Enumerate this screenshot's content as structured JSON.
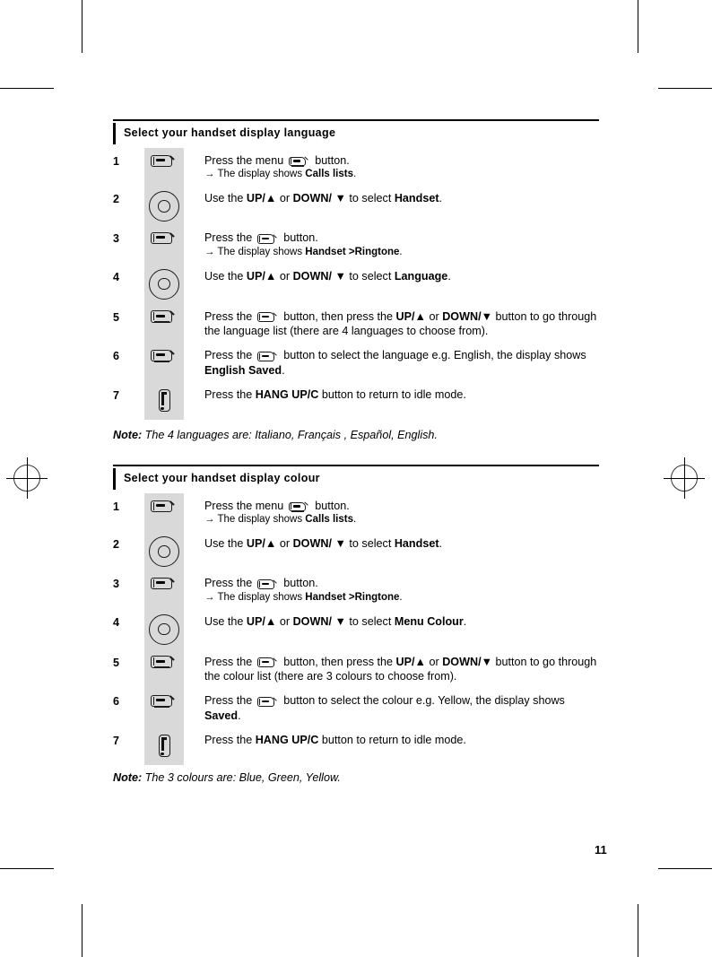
{
  "page": {
    "number": "11"
  },
  "sections": [
    {
      "id": "language",
      "title": "Select your handset display language",
      "steps": [
        {
          "num": "1",
          "icon": "menu-button-icon",
          "lines": [
            {
              "parts": [
                {
                  "t": "Press the menu "
                },
                {
                  "icon": "menu"
                },
                {
                  "t": " button."
                }
              ]
            },
            {
              "sub": true,
              "parts": [
                {
                  "t": "→ The display shows "
                },
                {
                  "b": "Calls lists"
                },
                {
                  "t": "."
                }
              ]
            }
          ]
        },
        {
          "num": "2",
          "icon": "navigation-wheel-icon",
          "lines": [
            {
              "parts": [
                {
                  "t": "Use the "
                },
                {
                  "b": "UP/▲"
                },
                {
                  "t": " or "
                },
                {
                  "b": "DOWN/ ▼"
                },
                {
                  "t": " to select "
                },
                {
                  "b": "Handset"
                },
                {
                  "t": "."
                }
              ]
            }
          ]
        },
        {
          "num": "3",
          "icon": "menu-button-icon",
          "lines": [
            {
              "parts": [
                {
                  "t": "Press the "
                },
                {
                  "icon": "menu"
                },
                {
                  "t": " button."
                }
              ]
            },
            {
              "sub": true,
              "parts": [
                {
                  "t": "→ The display shows "
                },
                {
                  "b": "Handset  >Ringtone"
                },
                {
                  "t": "."
                }
              ]
            }
          ]
        },
        {
          "num": "4",
          "icon": "navigation-wheel-icon",
          "lines": [
            {
              "parts": [
                {
                  "t": "Use the "
                },
                {
                  "b": "UP/▲"
                },
                {
                  "t": " or "
                },
                {
                  "b": "DOWN/ ▼"
                },
                {
                  "t": " to select "
                },
                {
                  "b": "Language"
                },
                {
                  "t": "."
                }
              ]
            }
          ]
        },
        {
          "num": "5",
          "icon": "menu-button-icon",
          "lines": [
            {
              "parts": [
                {
                  "t": "Press the "
                },
                {
                  "icon": "menu"
                },
                {
                  "t": " button, then press the "
                },
                {
                  "b": "UP/▲"
                },
                {
                  "t": " or "
                },
                {
                  "b": "DOWN/▼"
                },
                {
                  "t": " button to go through the language list (there are 4 languages to choose from)."
                }
              ]
            }
          ]
        },
        {
          "num": "6",
          "icon": "menu-button-icon",
          "lines": [
            {
              "parts": [
                {
                  "t": "Press the "
                },
                {
                  "icon": "menu"
                },
                {
                  "t": " button to select the language e.g. English, the display shows "
                },
                {
                  "b": "English Saved"
                },
                {
                  "t": "."
                }
              ]
            }
          ]
        },
        {
          "num": "7",
          "icon": "hang-up-icon",
          "lines": [
            {
              "parts": [
                {
                  "t": "Press the "
                },
                {
                  "b": "HANG UP/C"
                },
                {
                  "t": " button to return to idle mode."
                }
              ]
            }
          ]
        }
      ],
      "note_label": "Note:",
      "note_text": " The 4 languages are: Italiano, Français , Español, English."
    },
    {
      "id": "colour",
      "title": "Select your handset display colour",
      "steps": [
        {
          "num": "1",
          "icon": "menu-button-icon",
          "lines": [
            {
              "parts": [
                {
                  "t": "Press the menu "
                },
                {
                  "icon": "menu"
                },
                {
                  "t": " button."
                }
              ]
            },
            {
              "sub": true,
              "parts": [
                {
                  "t": "→ The display shows "
                },
                {
                  "b": "Calls lists"
                },
                {
                  "t": "."
                }
              ]
            }
          ]
        },
        {
          "num": "2",
          "icon": "navigation-wheel-icon",
          "lines": [
            {
              "parts": [
                {
                  "t": "Use the "
                },
                {
                  "b": "UP/▲"
                },
                {
                  "t": " or "
                },
                {
                  "b": "DOWN/ ▼"
                },
                {
                  "t": " to select "
                },
                {
                  "b": "Handset"
                },
                {
                  "t": "."
                }
              ]
            }
          ]
        },
        {
          "num": "3",
          "icon": "menu-button-icon",
          "lines": [
            {
              "parts": [
                {
                  "t": "Press the "
                },
                {
                  "icon": "menu"
                },
                {
                  "t": " button."
                }
              ]
            },
            {
              "sub": true,
              "parts": [
                {
                  "t": "→ The display shows "
                },
                {
                  "b": "Handset  >Ringtone"
                },
                {
                  "t": "."
                }
              ]
            }
          ]
        },
        {
          "num": "4",
          "icon": "navigation-wheel-icon",
          "lines": [
            {
              "parts": [
                {
                  "t": "Use the "
                },
                {
                  "b": "UP/▲"
                },
                {
                  "t": " or "
                },
                {
                  "b": "DOWN/ ▼"
                },
                {
                  "t": " to select "
                },
                {
                  "b": "Menu Colour"
                },
                {
                  "t": "."
                }
              ]
            }
          ]
        },
        {
          "num": "5",
          "icon": "menu-button-icon",
          "lines": [
            {
              "parts": [
                {
                  "t": "Press the "
                },
                {
                  "icon": "menu"
                },
                {
                  "t": " button, then press the "
                },
                {
                  "b": "UP/▲"
                },
                {
                  "t": " or "
                },
                {
                  "b": "DOWN/▼"
                },
                {
                  "t": " button to go through the colour list (there are 3 colours to choose from)."
                }
              ]
            }
          ]
        },
        {
          "num": "6",
          "icon": "menu-button-icon",
          "lines": [
            {
              "parts": [
                {
                  "t": "Press the "
                },
                {
                  "icon": "menu"
                },
                {
                  "t": " button to select the colour e.g. Yellow, the display shows "
                },
                {
                  "b": "Saved"
                },
                {
                  "t": "."
                }
              ]
            }
          ]
        },
        {
          "num": "7",
          "icon": "hang-up-icon",
          "lines": [
            {
              "parts": [
                {
                  "t": "Press the "
                },
                {
                  "b": "HANG UP/C"
                },
                {
                  "t": " button to return to idle mode."
                }
              ]
            }
          ]
        }
      ],
      "note_label": "Note:",
      "note_text": " The 3 colours are: Blue, Green, Yellow."
    }
  ],
  "colors": {
    "icon_column_bg": "#d9d9d9",
    "rule": "#000000",
    "text": "#000000"
  }
}
